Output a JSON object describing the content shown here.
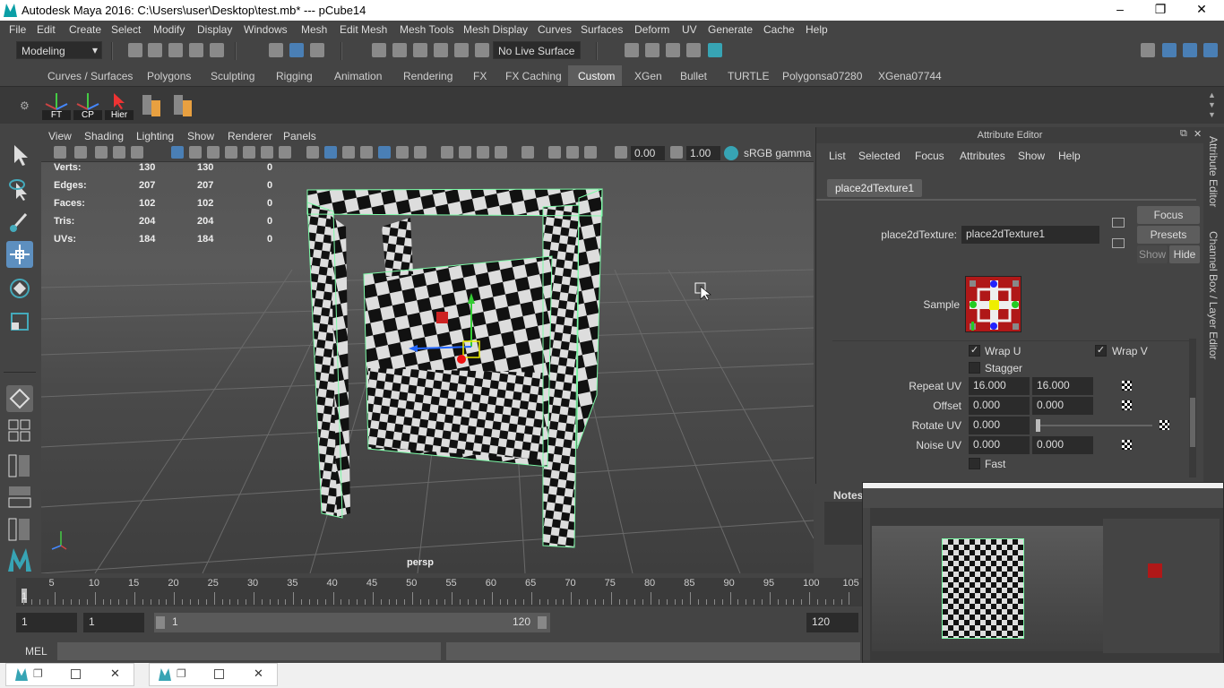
{
  "window": {
    "title": "Autodesk Maya 2016: C:\\Users\\user\\Desktop\\test.mb*   ---   pCube14",
    "minimize_glyph": "–",
    "restore_glyph": "❐",
    "close_glyph": "✕"
  },
  "menus": [
    "File",
    "Edit",
    "Create",
    "Select",
    "Modify",
    "Display",
    "Windows",
    "Mesh",
    "Edit Mesh",
    "Mesh Tools",
    "Mesh Display",
    "Curves",
    "Surfaces",
    "Deform",
    "UV",
    "Generate",
    "Cache",
    "Help"
  ],
  "statusline": {
    "mode": "Modeling",
    "live_surface": "No Live Surface"
  },
  "shelf_tabs": [
    "Curves / Surfaces",
    "Polygons",
    "Sculpting",
    "Rigging",
    "Animation",
    "Rendering",
    "FX",
    "FX Caching",
    "Custom",
    "XGen",
    "Bullet",
    "TURTLE",
    "Polygonsa07280",
    "XGena07744"
  ],
  "shelf_tabs_selected": "Custom",
  "shelf_buttons": [
    "FT",
    "CP",
    "Hier"
  ],
  "panel_menu": [
    "View",
    "Shading",
    "Lighting",
    "Show",
    "Renderer",
    "Panels"
  ],
  "panel_tools": {
    "exposure": "0.00",
    "gamma": "1.00",
    "color_space": "sRGB gamma"
  },
  "hud": [
    {
      "label": "Verts:",
      "a": "130",
      "b": "130",
      "c": "0"
    },
    {
      "label": "Edges:",
      "a": "207",
      "b": "207",
      "c": "0"
    },
    {
      "label": "Faces:",
      "a": "102",
      "b": "102",
      "c": "0"
    },
    {
      "label": "Tris:",
      "a": "204",
      "b": "204",
      "c": "0"
    },
    {
      "label": "UVs:",
      "a": "184",
      "b": "184",
      "c": "0"
    }
  ],
  "viewport_camera": "persp",
  "timeline": {
    "ticks": [
      "5",
      "10",
      "15",
      "20",
      "25",
      "30",
      "35",
      "40",
      "45",
      "50",
      "55",
      "60",
      "65",
      "70",
      "75",
      "80",
      "85",
      "90",
      "95",
      "100",
      "105"
    ],
    "current_frame": "1"
  },
  "range": {
    "start": "1",
    "playback_start": "1",
    "slider_start": "1",
    "slider_end": "120",
    "end": "120"
  },
  "command_line": {
    "lang": "MEL"
  },
  "attribute_editor": {
    "title": "Attribute Editor",
    "menu": [
      "List",
      "Selected",
      "Focus",
      "Attributes",
      "Show",
      "Help"
    ],
    "node_tab": "place2dTexture1",
    "node_type_label": "place2dTexture:",
    "node_name": "place2dTexture1",
    "focus_btn": "Focus",
    "presets_btn": "Presets",
    "show_btn": "Show",
    "hide_btn": "Hide",
    "sample_label": "Sample",
    "wrap_u": "Wrap U",
    "wrap_v": "Wrap V",
    "stagger": "Stagger",
    "repeat_uv_label": "Repeat UV",
    "repeat_u": "16.000",
    "repeat_v": "16.000",
    "offset_label": "Offset",
    "offset_u": "0.000",
    "offset_v": "0.000",
    "rotate_uv_label": "Rotate UV",
    "rotate_uv": "0.000",
    "noise_uv_label": "Noise UV",
    "noise_u": "0.000",
    "noise_v": "0.000",
    "fast": "Fast"
  },
  "side_tabs": [
    "Attribute Editor",
    "Channel Box / Layer Editor"
  ],
  "notes_label": "Notes",
  "colors": {
    "ui_bg": "#444444",
    "accent_cyan": "#37a4b4",
    "selection_green": "#7dfca8"
  }
}
